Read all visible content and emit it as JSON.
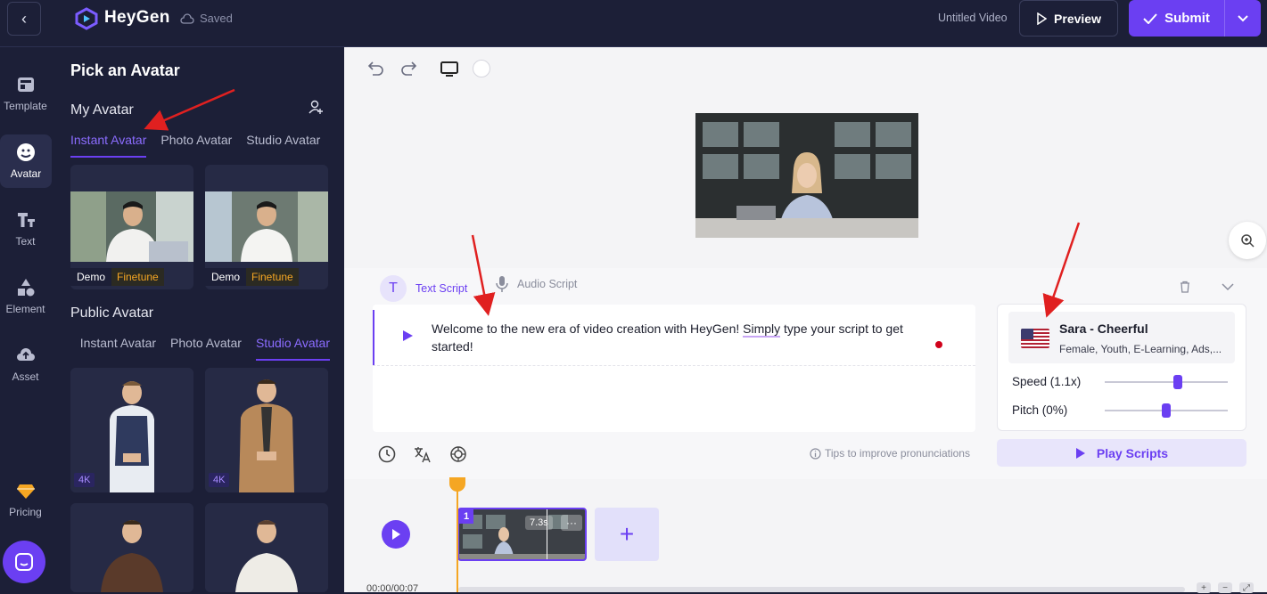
{
  "header": {
    "brand": "HeyGen",
    "saved": "Saved",
    "video_title": "Untitled Video",
    "preview_label": "Preview",
    "submit_label": "Submit"
  },
  "nav": {
    "items": [
      {
        "label": "Template"
      },
      {
        "label": "Avatar"
      },
      {
        "label": "Text"
      },
      {
        "label": "Element"
      },
      {
        "label": "Asset"
      },
      {
        "label": "Pricing"
      }
    ]
  },
  "panel": {
    "title": "Pick an Avatar",
    "my_avatar": "My Avatar",
    "my_tabs": [
      "Instant Avatar",
      "Photo Avatar",
      "Studio Avatar"
    ],
    "my_cards": [
      {
        "badge1": "Demo",
        "badge2": "Finetune"
      },
      {
        "badge1": "Demo",
        "badge2": "Finetune"
      }
    ],
    "public_avatar": "Public Avatar",
    "public_tabs": [
      "Instant Avatar",
      "Photo Avatar",
      "Studio Avatar"
    ],
    "public_cards": [
      {
        "badge": "4K"
      },
      {
        "badge": "4K"
      }
    ]
  },
  "script": {
    "text_tab": "Text Script",
    "audio_tab": "Audio Script",
    "text_before": "Welcome to the new era of video creation with HeyGen! ",
    "text_underlined": "Simply",
    "text_after": " type your script to get started!",
    "tips": "Tips to improve pronunciations"
  },
  "voice": {
    "name": "Sara - Cheerful",
    "desc": "Female, Youth, E-Learning, Ads,...",
    "speed_label": "Speed (1.1x)",
    "speed_level": 0.6,
    "pitch_label": "Pitch (0%)",
    "pitch_level": 0.5,
    "play_label": "Play Scripts"
  },
  "timeline": {
    "clip_number": "1",
    "clip_duration": "7.3s",
    "clip_more": "···",
    "timecode": "00:00/00:07"
  },
  "colors": {
    "accent": "#6b3ff2",
    "dark_bg": "#1c1f37",
    "playhead": "#f5a623",
    "annotation_arrow": "#e02020"
  }
}
